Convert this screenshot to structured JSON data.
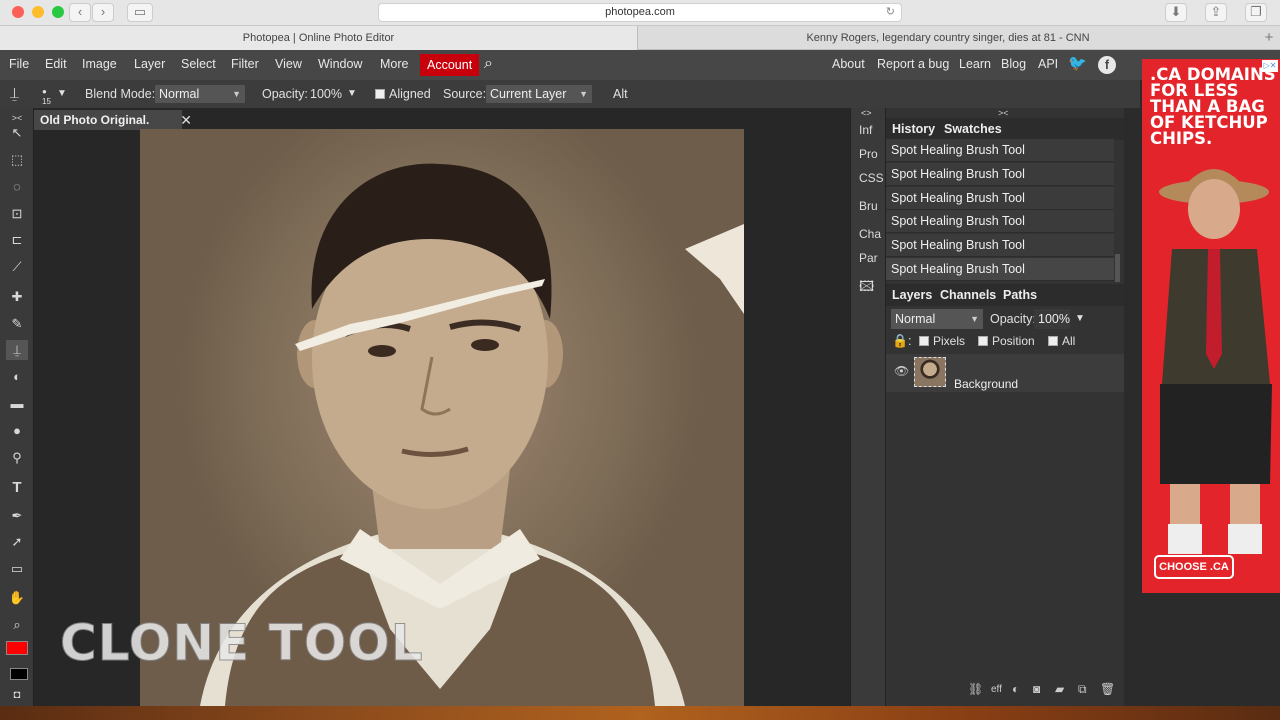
{
  "browser": {
    "url": "photopea.com",
    "tabs": [
      {
        "title": "Photopea | Online Photo Editor"
      },
      {
        "title": "Kenny Rogers, legendary country singer, dies at 81 - CNN"
      }
    ],
    "plus": "+"
  },
  "menu": {
    "items": [
      "File",
      "Edit",
      "Image",
      "Layer",
      "Select",
      "Filter",
      "View",
      "Window",
      "More"
    ],
    "account": "Account",
    "right": [
      "About",
      "Report a bug",
      "Learn",
      "Blog",
      "API"
    ],
    "accent": "#cc0000"
  },
  "options": {
    "brush_size": "15",
    "blend_label": "Blend Mode:",
    "blend_value": "Normal",
    "opacity_label": "Opacity:",
    "opacity_value": "100%",
    "aligned_label": "Aligned",
    "source_label": "Source:",
    "source_value": "Current Layer",
    "alt_label": "Alt"
  },
  "document": {
    "tab_title": "Old Photo Original.",
    "overlay_text": "CLONE TOOL"
  },
  "sidecol": [
    "Inf",
    "Pro",
    "CSS",
    "Bru",
    "Cha",
    "Par"
  ],
  "history": {
    "tabs": [
      "History",
      "Swatches"
    ],
    "items": [
      "Spot Healing Brush Tool",
      "Spot Healing Brush Tool",
      "Spot Healing Brush Tool",
      "Spot Healing Brush Tool",
      "Spot Healing Brush Tool",
      "Spot Healing Brush Tool"
    ]
  },
  "layers": {
    "tabs": [
      "Layers",
      "Channels",
      "Paths"
    ],
    "blend": "Normal",
    "opacity_label": "Opacity:",
    "opacity_value": "100%",
    "lock_items": [
      "Pixels",
      "Position",
      "All"
    ],
    "layer_name": "Background"
  },
  "bottom_icons": [
    "link-icon",
    "eff",
    "adjustment-icon",
    "mask-icon",
    "folder-icon",
    "new-layer-icon",
    "trash-icon"
  ],
  "ad": {
    "headline": ".CA DOMAINS FOR LESS THAN A BAG OF KETCHUP CHIPS.",
    "cta": "CHOOSE .CA",
    "color": "#e3242b"
  },
  "colors": {
    "foreground": "#ff0000",
    "background": "#000000"
  }
}
